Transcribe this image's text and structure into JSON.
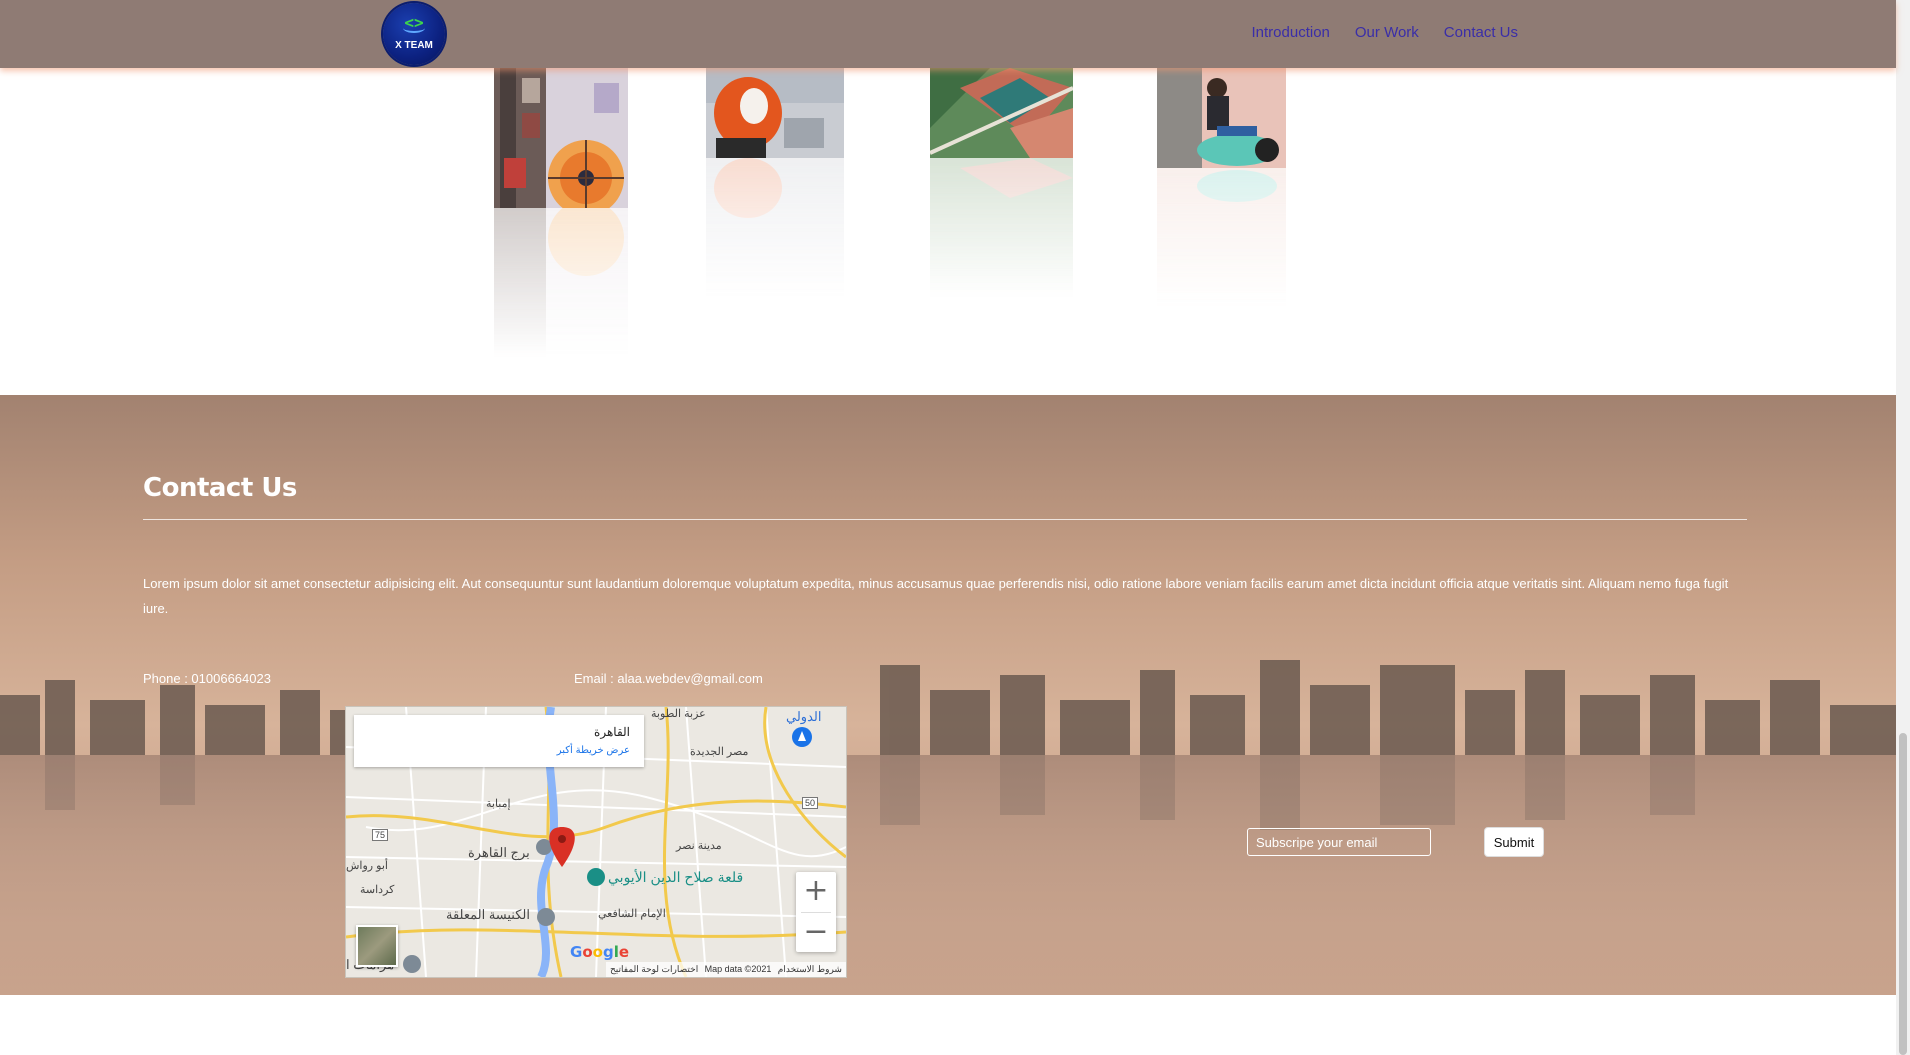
{
  "nav": {
    "logo_text": "X TEAM",
    "logo_symbol": "<>",
    "links": [
      "Introduction",
      "Our Work",
      "Contact Us"
    ]
  },
  "gallery": {
    "tiles": [
      "ferris-wheel-photo",
      "scooter-photo",
      "rooftop-aerial-photo",
      "rider-photo"
    ]
  },
  "contact": {
    "title": "Contact Us",
    "paragraph": "Lorem ipsum dolor sit amet consectetur adipisicing elit. Aut consequuntur sunt laudantium doloremque voluptatum expedita, minus accusamus quae perferendis nisi, odio ratione labore veniam facilis earum amet dicta incidunt officia atque veritatis sint. Aliquam nemo fuga fugit iure.",
    "phone": "Phone : 01006664023",
    "email": "Email : alaa.webdev@gmail.com"
  },
  "map": {
    "place_name": "القاهرة",
    "bigger_map_link": "عرض خريطة أكبر",
    "labels": [
      "عزبة الطوبة",
      "الدولي",
      "مصر الجديدة",
      "إمبابة",
      "برج القاهرة",
      "مدينة نصر",
      "قلعة صلاح الدين الأيوبي",
      "أبو رواش",
      "كرداسة",
      "الإمام الشافعي",
      "الكنيسة المعلقة",
      "هرامات ا",
      "75",
      "50"
    ],
    "zoom_in": "+",
    "zoom_out": "−",
    "google": "Google",
    "keyboard_shortcuts": "اختصارات لوحة المفاتيح",
    "map_data": "Map data ©2021",
    "terms": "شروط الاستخدام"
  },
  "subscribe": {
    "placeholder": "Subscripe your email",
    "submit_label": "Submit"
  },
  "colors": {
    "navbar": "#8f7b74",
    "nav_link": "#3a2ea8",
    "contact_bg": "#c49d84",
    "logo_bg": "#0c2180"
  }
}
